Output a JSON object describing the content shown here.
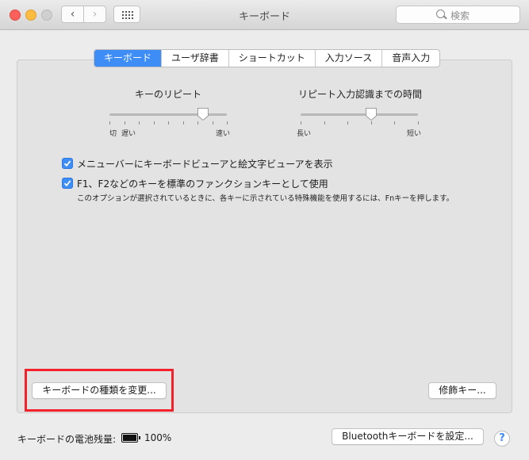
{
  "window": {
    "title": "キーボード"
  },
  "toolbar": {
    "back": "‹",
    "forward": "›",
    "search_placeholder": "検索"
  },
  "tabs": [
    {
      "label": "キーボード",
      "active": true
    },
    {
      "label": "ユーザ辞書",
      "active": false
    },
    {
      "label": "ショートカット",
      "active": false
    },
    {
      "label": "入力ソース",
      "active": false
    },
    {
      "label": "音声入力",
      "active": false
    }
  ],
  "key_repeat": {
    "title": "キーのリピート",
    "label_off": "切",
    "label_slow": "遅い",
    "label_fast": "速い",
    "level": 0.8
  },
  "repeat_delay": {
    "title": "リピート入力認識までの時間",
    "label_long": "長い",
    "label_short": "短い",
    "level": 0.6
  },
  "options": {
    "show_viewer": {
      "checked": true,
      "label": "メニューバーにキーボードビューアと絵文字ビューアを表示"
    },
    "fn_keys": {
      "checked": true,
      "label": "F1、F2などのキーを標準のファンクションキーとして使用",
      "note": "このオプションが選択されているときに、各キーに示されている特殊機能を使用するには、Fnキーを押します。"
    }
  },
  "buttons": {
    "change_type": "キーボードの種類を変更...",
    "modifier": "修飾キー...",
    "bluetooth": "Bluetoothキーボードを設定...",
    "help": "?"
  },
  "battery": {
    "label": "キーボードの電池残量:",
    "percent": "100%"
  },
  "colors": {
    "accent": "#3e8df7",
    "highlight": "#f5212a"
  }
}
